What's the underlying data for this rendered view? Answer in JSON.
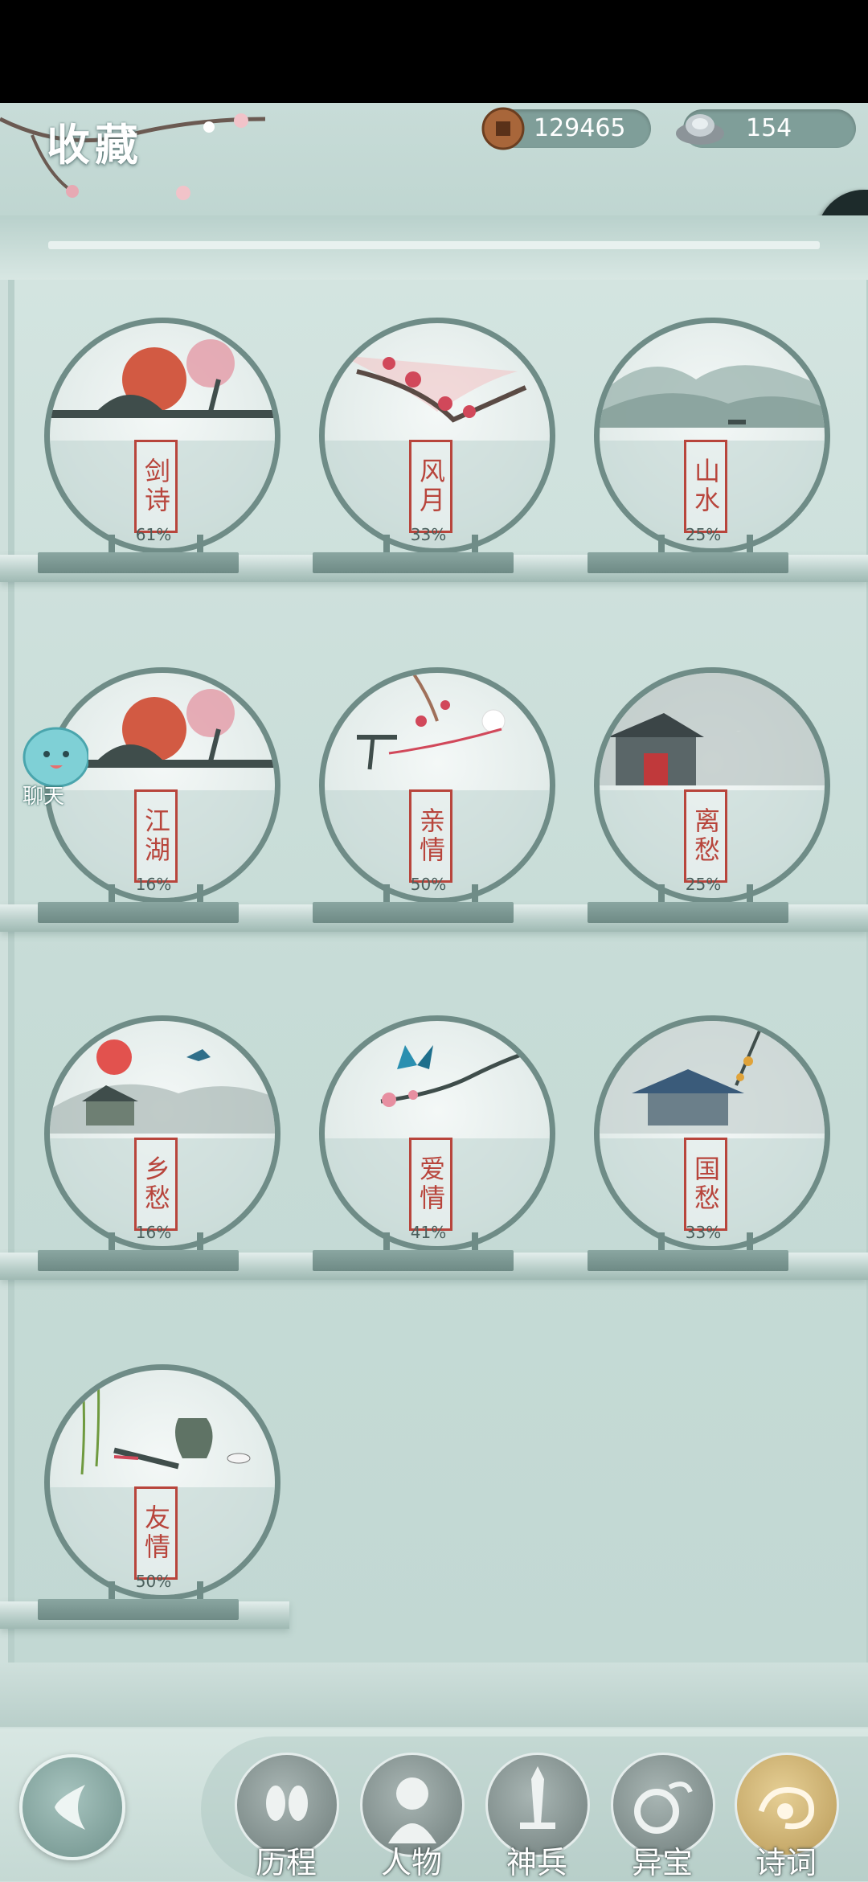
{
  "header": {
    "title": "收藏"
  },
  "resources": {
    "coins": "129465",
    "silver": "154"
  },
  "chat": {
    "label": "聊天"
  },
  "collections": [
    {
      "name": "剑诗",
      "percent": "61%",
      "art": "bridge-sun"
    },
    {
      "name": "风月",
      "percent": "33%",
      "art": "plum-blossom"
    },
    {
      "name": "山水",
      "percent": "25%",
      "art": "mountains"
    },
    {
      "name": "江湖",
      "percent": "16%",
      "art": "bridge-sun"
    },
    {
      "name": "亲情",
      "percent": "50%",
      "art": "needle-thread"
    },
    {
      "name": "离愁",
      "percent": "25%",
      "art": "moon-pavilion"
    },
    {
      "name": "乡愁",
      "percent": "16%",
      "art": "village-sunset"
    },
    {
      "name": "爱情",
      "percent": "41%",
      "art": "butterfly-branch"
    },
    {
      "name": "国愁",
      "percent": "33%",
      "art": "rain-palace"
    },
    {
      "name": "友情",
      "percent": "50%",
      "art": "willow-wine"
    }
  ],
  "nav": {
    "tabs": [
      {
        "label": "历程",
        "icon": "footprints-icon"
      },
      {
        "label": "人物",
        "icon": "person-icon"
      },
      {
        "label": "神兵",
        "icon": "sword-icon"
      },
      {
        "label": "异宝",
        "icon": "treasure-icon"
      },
      {
        "label": "诗词",
        "icon": "scroll-icon",
        "active": true
      }
    ]
  },
  "colors": {
    "seal": "#b8453c",
    "frame": "#6f8c87",
    "active_tab": "#c9ab68"
  }
}
